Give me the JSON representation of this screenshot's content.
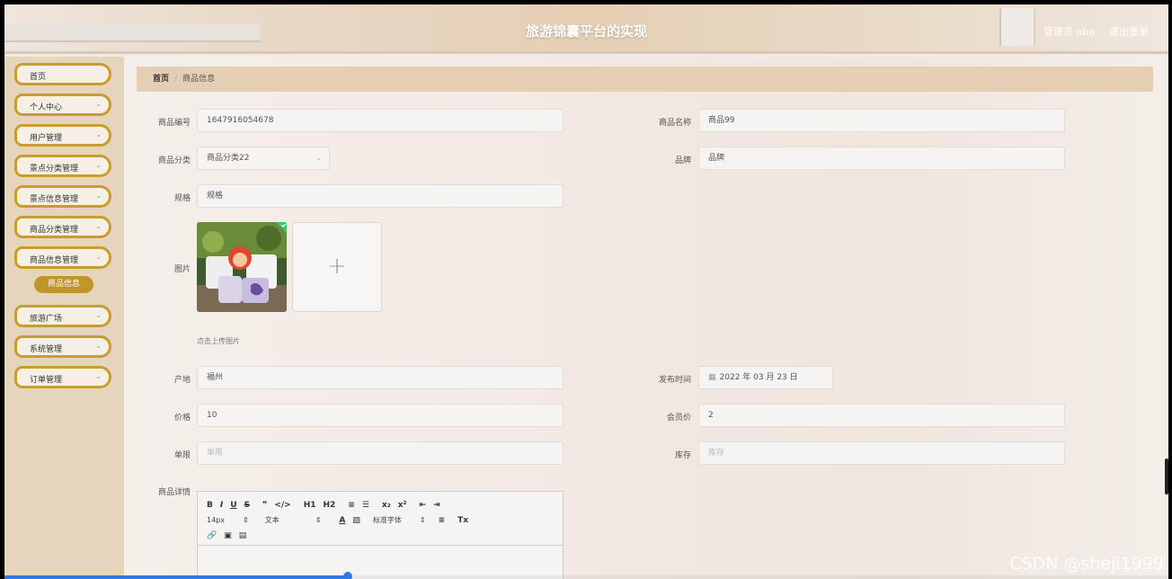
{
  "header": {
    "title": "旅游锦囊平台的实现",
    "user": "管理员 abo",
    "logout": "退出登录"
  },
  "sidebar": {
    "items": [
      {
        "label": "首页",
        "chevron": false
      },
      {
        "label": "个人中心",
        "chevron": true
      },
      {
        "label": "用户管理",
        "chevron": true
      },
      {
        "label": "景点分类管理",
        "chevron": true
      },
      {
        "label": "景点信息管理",
        "chevron": true
      },
      {
        "label": "商品分类管理",
        "chevron": true
      },
      {
        "label": "商品信息管理",
        "chevron": true
      },
      {
        "label": "旅游广场",
        "chevron": true
      },
      {
        "label": "系统管理",
        "chevron": true
      },
      {
        "label": "订单管理",
        "chevron": true
      }
    ],
    "active_sub": "商品信息"
  },
  "breadcrumb": {
    "home": "首页",
    "sep": "/",
    "current": "商品信息"
  },
  "form": {
    "code": {
      "label": "商品编号",
      "value": "1647916054678"
    },
    "name": {
      "label": "商品名称",
      "value": "商品99"
    },
    "category": {
      "label": "商品分类",
      "value": "商品分类22"
    },
    "brand": {
      "label": "品牌",
      "value": "品牌"
    },
    "spec": {
      "label": "规格",
      "value": "规格"
    },
    "image": {
      "label": "图片",
      "tip": "点击上传图片",
      "add": "+"
    },
    "origin": {
      "label": "产地",
      "value": "福州"
    },
    "date": {
      "label": "发布时间",
      "value": "2022 年 03 月 23 日"
    },
    "price": {
      "label": "价格",
      "value": "10"
    },
    "member": {
      "label": "会员价",
      "value": "2"
    },
    "limit": {
      "label": "单限",
      "placeholder": "单限"
    },
    "stock": {
      "label": "库存",
      "placeholder": "库存"
    },
    "detail": {
      "label": "商品详情"
    }
  },
  "editor": {
    "row1": [
      "B",
      "I",
      "U",
      "S",
      "❞",
      "</>",
      "H1",
      "H2",
      "≡",
      "☰",
      "x₂",
      "x²",
      "⇤",
      "⇥"
    ],
    "font_size": "14px",
    "paragraph": "文本",
    "font_family": "标准字体",
    "row2_icons": [
      "A",
      "▨",
      "≡",
      "Tx"
    ],
    "row3": [
      "🔗",
      "▣",
      "▤"
    ]
  },
  "watermark": "CSDN @sheji1999",
  "video_progress": 0.295
}
